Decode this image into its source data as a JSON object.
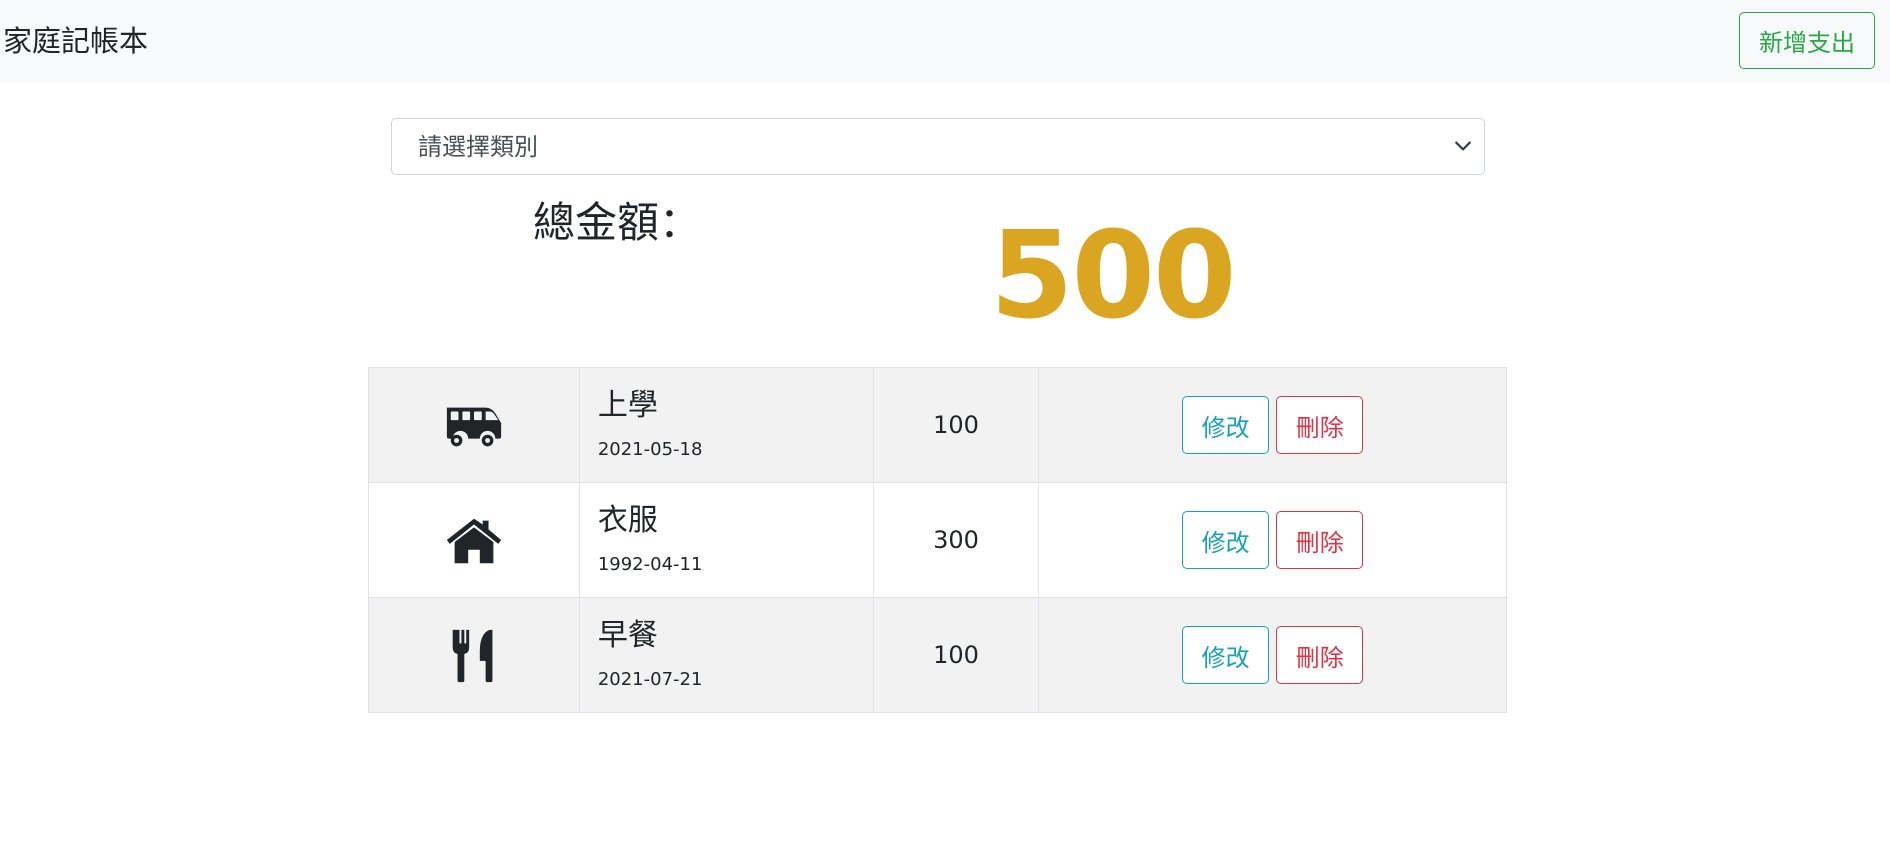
{
  "header": {
    "brand": "家庭記帳本",
    "add_label": "新增支出"
  },
  "filter": {
    "selected": "請選擇類別"
  },
  "summary": {
    "label": "總金額：",
    "total": "500"
  },
  "colors": {
    "accent_total": "#daa520",
    "add_button": "#28a745",
    "edit_button": "#17a2b8",
    "delete_button": "#dc3545"
  },
  "records": [
    {
      "icon": "bus-icon",
      "title": "上學",
      "date": "2021-05-18",
      "amount": "100",
      "edit_label": "修改",
      "delete_label": "刪除"
    },
    {
      "icon": "home-icon",
      "title": "衣服",
      "date": "1992-04-11",
      "amount": "300",
      "edit_label": "修改",
      "delete_label": "刪除"
    },
    {
      "icon": "utensils-icon",
      "title": "早餐",
      "date": "2021-07-21",
      "amount": "100",
      "edit_label": "修改",
      "delete_label": "刪除"
    }
  ]
}
